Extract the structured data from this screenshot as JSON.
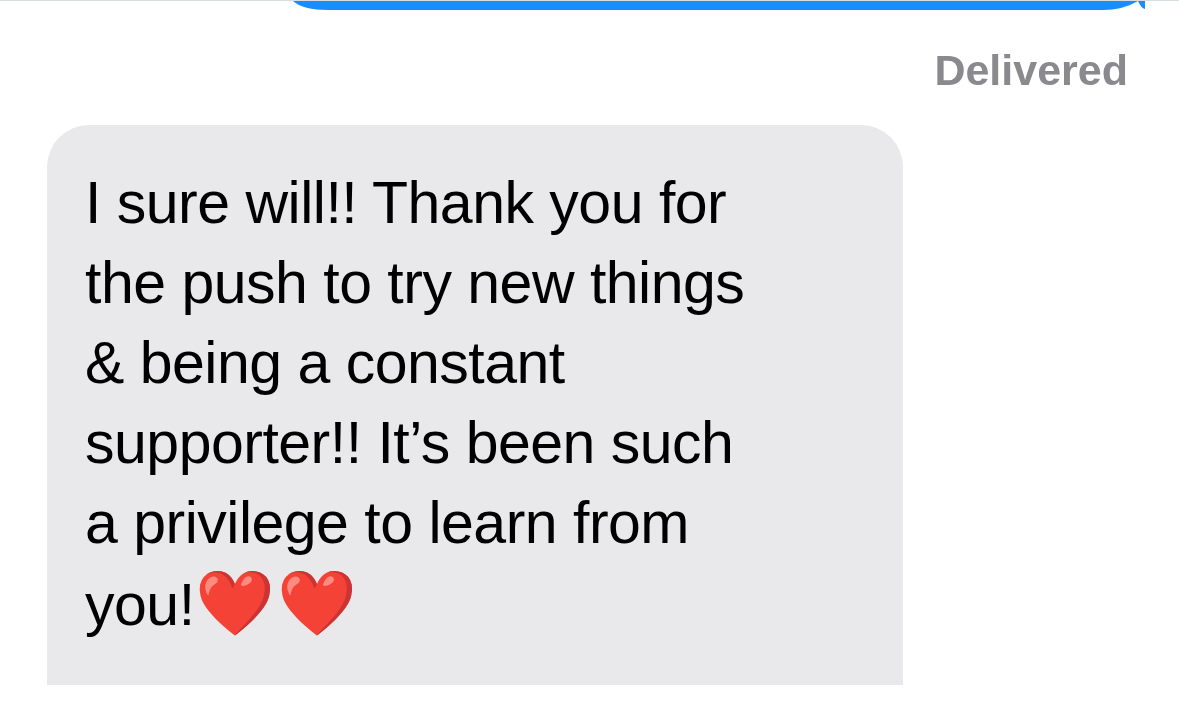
{
  "sent_message": {
    "status": "Delivered"
  },
  "received_message": {
    "text": "I sure will!! Thank you for\nthe push to try new things\n& being a constant\nsupporter!! It’s been such\na privilege to learn from\nyou!",
    "emoji": [
      "❤️",
      "❤️"
    ]
  }
}
